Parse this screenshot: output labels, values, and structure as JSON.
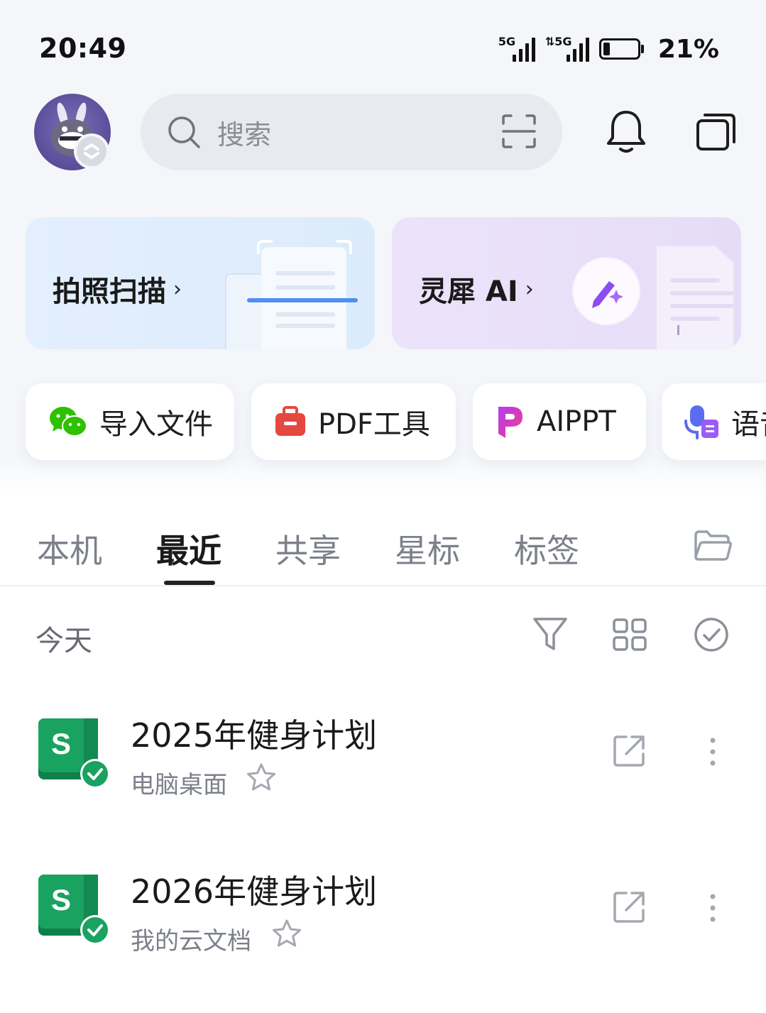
{
  "status_bar": {
    "time": "20:49",
    "signal_1_tag": "5G",
    "signal_2_tag": "⇅5G",
    "battery_percent": "21%",
    "battery_level": 0.21
  },
  "header": {
    "search_placeholder": "搜索",
    "icons": [
      "avatar",
      "search-icon",
      "scan-icon",
      "bell-icon",
      "windows-icon"
    ]
  },
  "banners": {
    "scan": {
      "label": "拍照扫描",
      "chevron": "›"
    },
    "ai": {
      "label": "灵犀 AI",
      "chevron": "›"
    }
  },
  "tools": [
    {
      "label": "导入文件",
      "icon": "wechat-icon"
    },
    {
      "label": "PDF工具",
      "icon": "pdf-toolbox-icon"
    },
    {
      "label": "AIPPT",
      "icon": "aippt-icon"
    },
    {
      "label": "语音",
      "icon": "voice-icon"
    }
  ],
  "tabs": [
    {
      "label": "本机",
      "active": false
    },
    {
      "label": "最近",
      "active": true
    },
    {
      "label": "共享",
      "active": false
    },
    {
      "label": "星标",
      "active": false
    },
    {
      "label": "标签",
      "active": false
    }
  ],
  "section": {
    "title": "今天"
  },
  "files": [
    {
      "name": "2025年健身计划",
      "location": "电脑桌面",
      "icon_letter": "S",
      "starred": false
    },
    {
      "name": "2026年健身计划",
      "location": "我的云文档",
      "icon_letter": "S",
      "starred": false
    }
  ],
  "colors": {
    "sheet_green": "#1aa260",
    "sheet_green_dark": "#0f8048",
    "pdf_red": "#e5483f",
    "ai_purple": "#8c4cf0",
    "wechat_green": "#2dc100"
  }
}
